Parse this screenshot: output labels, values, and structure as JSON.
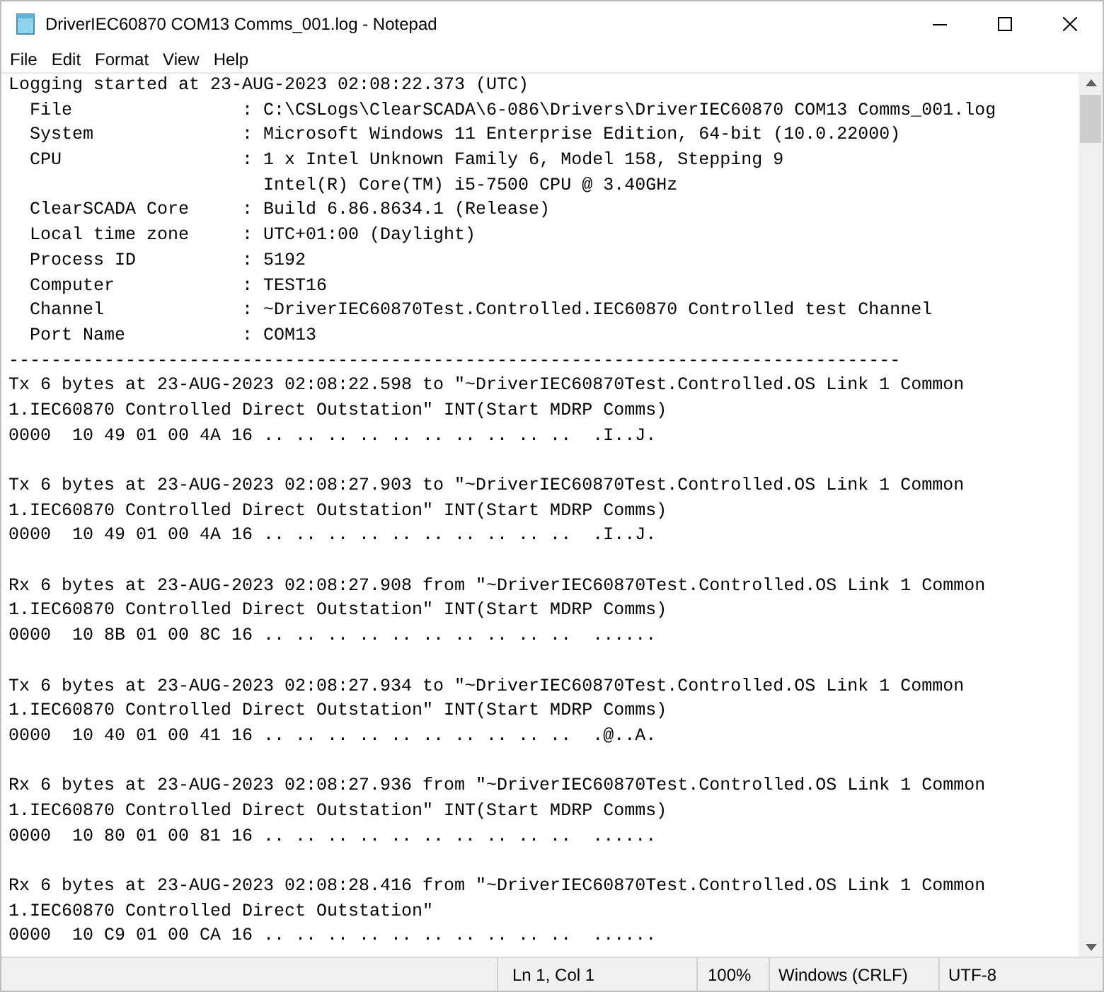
{
  "window": {
    "title": "DriverIEC60870 COM13 Comms_001.log - Notepad"
  },
  "menu": [
    "File",
    "Edit",
    "Format",
    "View",
    "Help"
  ],
  "header": [
    "Logging started at 23-AUG-2023 02:08:22.373 (UTC)",
    "  File                : C:\\CSLogs\\ClearSCADA\\6-086\\Drivers\\DriverIEC60870 COM13 Comms_001.log",
    "  System              : Microsoft Windows 11 Enterprise Edition, 64-bit (10.0.22000)",
    "  CPU                 : 1 x Intel Unknown Family 6, Model 158, Stepping 9",
    "                        Intel(R) Core(TM) i5-7500 CPU @ 3.40GHz",
    "  ClearSCADA Core     : Build 6.86.8634.1 (Release)",
    "  Local time zone     : UTC+01:00 (Daylight)",
    "  Process ID          : 5192",
    "  Computer            : TEST16",
    "  Channel             : ~DriverIEC60870Test.Controlled.IEC60870 Controlled test Channel",
    "  Port Name           : COM13"
  ],
  "separator": "------------------------------------------------------------------------------------",
  "records": [
    [
      "Tx 6 bytes at 23-AUG-2023 02:08:22.598 to \"~DriverIEC60870Test.Controlled.OS Link 1 Common",
      "1.IEC60870 Controlled Direct Outstation\" INT(Start MDRP Comms)",
      "0000  10 49 01 00 4A 16 .. .. .. .. .. .. .. .. .. ..  .I..J."
    ],
    [
      "Tx 6 bytes at 23-AUG-2023 02:08:27.903 to \"~DriverIEC60870Test.Controlled.OS Link 1 Common",
      "1.IEC60870 Controlled Direct Outstation\" INT(Start MDRP Comms)",
      "0000  10 49 01 00 4A 16 .. .. .. .. .. .. .. .. .. ..  .I..J."
    ],
    [
      "Rx 6 bytes at 23-AUG-2023 02:08:27.908 from \"~DriverIEC60870Test.Controlled.OS Link 1 Common",
      "1.IEC60870 Controlled Direct Outstation\" INT(Start MDRP Comms)",
      "0000  10 8B 01 00 8C 16 .. .. .. .. .. .. .. .. .. ..  ......"
    ],
    [
      "Tx 6 bytes at 23-AUG-2023 02:08:27.934 to \"~DriverIEC60870Test.Controlled.OS Link 1 Common",
      "1.IEC60870 Controlled Direct Outstation\" INT(Start MDRP Comms)",
      "0000  10 40 01 00 41 16 .. .. .. .. .. .. .. .. .. ..  .@..A."
    ],
    [
      "Rx 6 bytes at 23-AUG-2023 02:08:27.936 from \"~DriverIEC60870Test.Controlled.OS Link 1 Common",
      "1.IEC60870 Controlled Direct Outstation\" INT(Start MDRP Comms)",
      "0000  10 80 01 00 81 16 .. .. .. .. .. .. .. .. .. ..  ......"
    ],
    [
      "Rx 6 bytes at 23-AUG-2023 02:08:28.416 from \"~DriverIEC60870Test.Controlled.OS Link 1 Common",
      "1.IEC60870 Controlled Direct Outstation\"",
      "0000  10 C9 01 00 CA 16 .. .. .. .. .. .. .. .. .. ..  ......"
    ]
  ],
  "status_bar": {
    "position": "Ln 1, Col 1",
    "zoom": "100%",
    "line_ending": "Windows (CRLF)",
    "encoding": "UTF-8"
  }
}
